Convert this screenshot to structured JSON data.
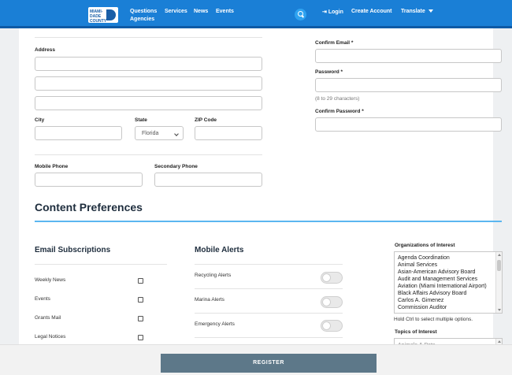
{
  "header": {
    "logo_text": "MIAMI-DADE COUNTY",
    "nav": [
      "Questions",
      "Services",
      "News",
      "Events"
    ],
    "nav_second_line": "Agencies",
    "login": "Login",
    "create_account": "Create Account",
    "translate": "Translate",
    "brand_color": "#1a7fd6"
  },
  "form": {
    "address_label": "Address",
    "city_label": "City",
    "state_label": "State",
    "state_value": "Florida",
    "zip_label": "ZIP Code",
    "mobile_label": "Mobile Phone",
    "secondary_label": "Secondary Phone",
    "confirm_email_label": "Confirm Email *",
    "password_label": "Password *",
    "password_hint": "(8 to 29 characters)",
    "confirm_password_label": "Confirm Password *"
  },
  "preferences": {
    "title": "Content Preferences",
    "email_title": "Email Subscriptions",
    "email_items": [
      "Weekly News",
      "Events",
      "Grants Mail",
      "Legal Notices"
    ],
    "mobile_title": "Mobile Alerts",
    "mobile_items": [
      "Recycling Alerts",
      "Marina Alerts",
      "Emergency Alerts"
    ],
    "orgs_label": "Organizations of Interest",
    "orgs": [
      "Agenda Coordination",
      "Animal Services",
      "Asian-American Advisory Board",
      "Audit and Management Services",
      "Aviation (Miami International Airport)",
      "Black Affairs Advisory Board",
      "Carlos A. Gimenez",
      "Commission Auditor"
    ],
    "orgs_hint": "Hold Ctrl to select multiple options.",
    "topics_label": "Topics of Interest",
    "topics_first": "Animals & Pets"
  },
  "footer": {
    "register_label": "REGISTER"
  }
}
